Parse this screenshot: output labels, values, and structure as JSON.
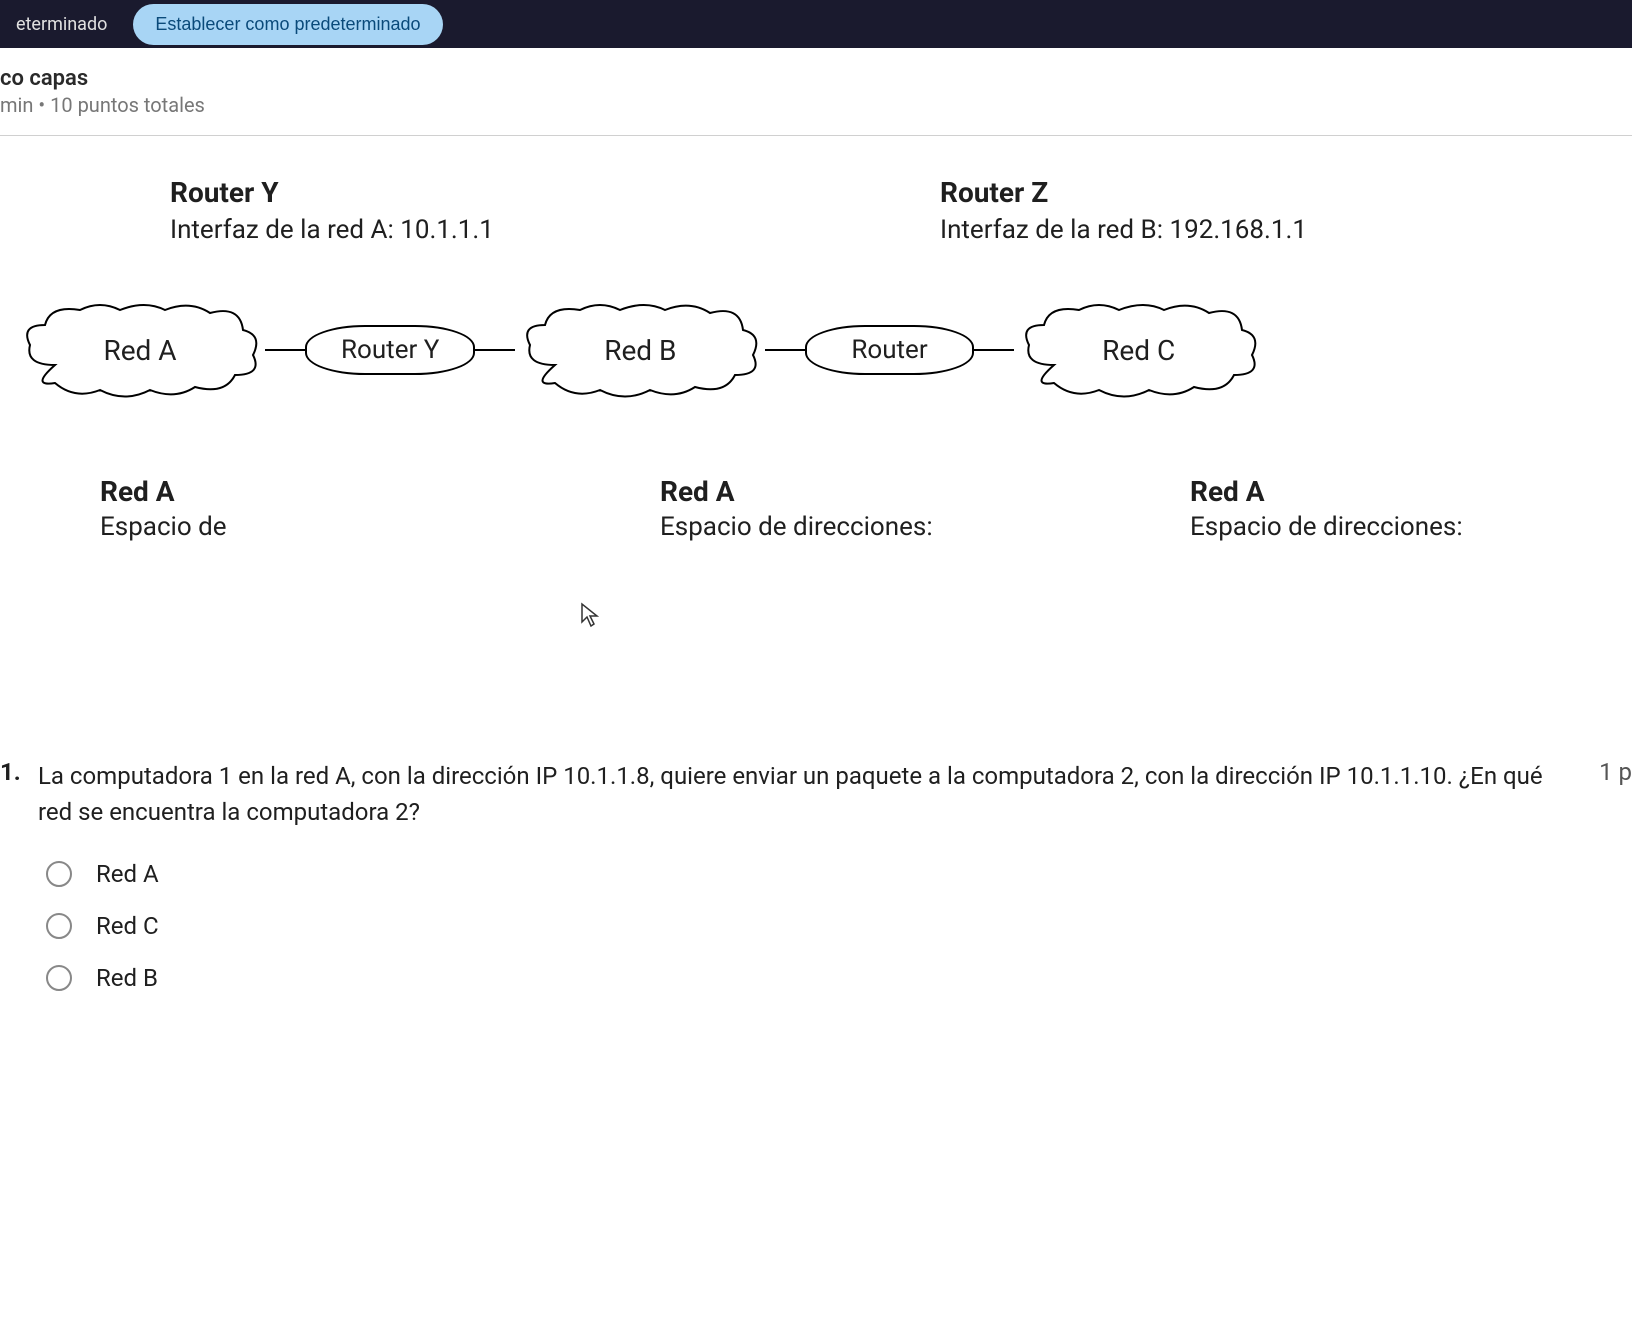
{
  "topbar": {
    "tab_label": "eterminado",
    "button_label": "Establecer como predeterminado"
  },
  "header": {
    "title": "co capas",
    "meta_prefix": "min",
    "meta_points": "10 puntos totales"
  },
  "diagram": {
    "router_y": {
      "name": "Router Y",
      "interface": "Interfaz de la red A: 10.1.1.1"
    },
    "router_z": {
      "name": "Router Z",
      "interface": "Interfaz de la red B: 192.168.1.1"
    },
    "nodes": {
      "net_a": "Red A",
      "router_y_cyl": "Router Y",
      "net_b": "Red B",
      "router_z_cyl": "Router",
      "net_c": "Red C"
    },
    "net_info": {
      "a": {
        "title": "Red A",
        "sub": "Espacio de"
      },
      "b": {
        "title": "Red A",
        "sub": "Espacio de direcciones:"
      },
      "c": {
        "title": "Red A",
        "sub": "Espacio de direcciones:"
      }
    }
  },
  "question": {
    "number": "1.",
    "text": "La computadora 1 en la red A, con la dirección IP 10.1.1.8, quiere enviar un paquete a la computadora 2, con la dirección IP 10.1.1.10. ¿En qué red se encuentra la computadora 2?",
    "points": "1 p",
    "options": [
      "Red A",
      "Red C",
      "Red B"
    ]
  }
}
